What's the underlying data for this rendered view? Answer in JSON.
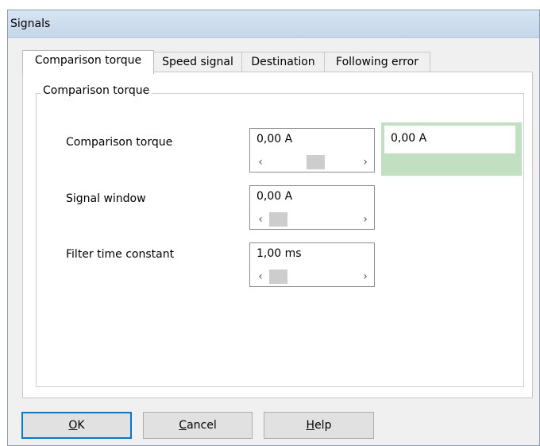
{
  "window": {
    "title": "Signals"
  },
  "tabs": [
    {
      "label": "Comparison torque",
      "active": true
    },
    {
      "label": "Speed signal",
      "active": false
    },
    {
      "label": "Destination",
      "active": false
    },
    {
      "label": "Following error",
      "active": false
    }
  ],
  "group": {
    "title": "Comparison torque"
  },
  "fields": [
    {
      "label": "Comparison torque",
      "value": "0,00 A",
      "slider_fraction": 0.55
    },
    {
      "label": "Signal window",
      "value": "0,00 A",
      "slider_fraction": 0.0
    },
    {
      "label": "Filter time constant",
      "value": "1,00 ms",
      "slider_fraction": 0.0
    }
  ],
  "scroll_arrows": {
    "left": "‹",
    "right": "›"
  },
  "readout": {
    "value": "0,00 A",
    "background_color": "#c1e0c1"
  },
  "buttons": {
    "ok": {
      "mnemonic": "O",
      "rest": "K"
    },
    "cancel": {
      "mnemonic": "C",
      "rest": "ancel"
    },
    "help": {
      "mnemonic": "H",
      "rest": "elp"
    }
  },
  "colors": {
    "accent": "#0078d7",
    "titlebar": "#c9d9ec"
  }
}
